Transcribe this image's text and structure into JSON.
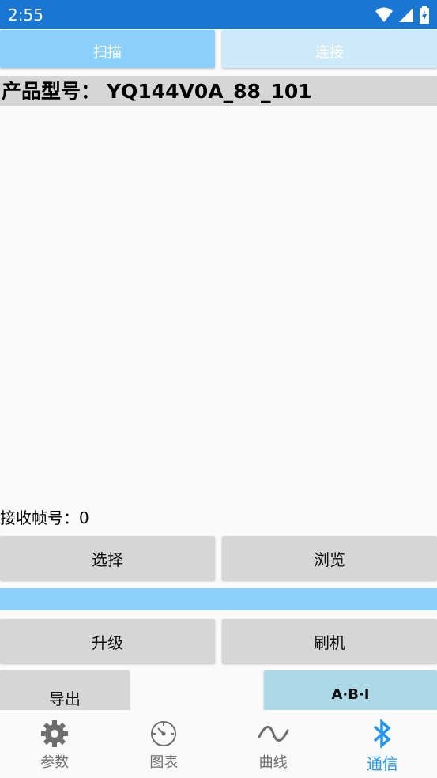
{
  "status_bar": {
    "time": "2:55"
  },
  "top_buttons": {
    "scan_label": "扫描",
    "connect_label": "连接"
  },
  "product": {
    "label": "产品型号：",
    "model": "YQ144V0A_88_101"
  },
  "receive": {
    "label": "接收帧号：",
    "value": "0"
  },
  "actions": {
    "select_label": "选择",
    "browse_label": "浏览",
    "upgrade_label": "升级",
    "flash_label": "刷机",
    "export_label": "导出",
    "abi_label": "A·B·I"
  },
  "progress": {
    "fraction": 1.0
  },
  "nav": {
    "items": [
      {
        "label": "参数",
        "icon": "gear-icon",
        "active": false
      },
      {
        "label": "图表",
        "icon": "gauge-icon",
        "active": false
      },
      {
        "label": "曲线",
        "icon": "wave-icon",
        "active": false
      },
      {
        "label": "通信",
        "icon": "bluetooth-icon",
        "active": true
      }
    ]
  },
  "colors": {
    "status_bar": "#1976d2",
    "accent": "#2196f3",
    "scan_button": "#8ad0fb",
    "connect_button": "#cde9fa",
    "abi_button": "#add8e6",
    "gray_button": "#d6d6d6"
  }
}
